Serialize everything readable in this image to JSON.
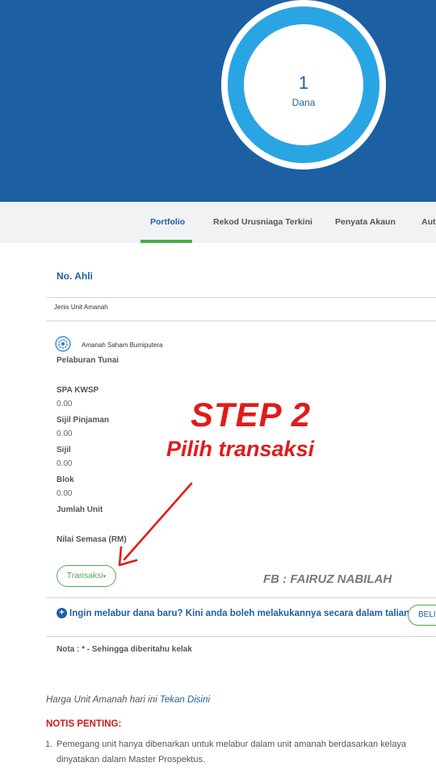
{
  "summary": {
    "count": "1",
    "label": "Dana"
  },
  "tabs": [
    {
      "label": "Portfolio",
      "active": true
    },
    {
      "label": "Rekod Urusniaga Terkini",
      "active": false
    },
    {
      "label": "Penyata Akaun",
      "active": false
    },
    {
      "label": "Aut",
      "active": false
    }
  ],
  "account": {
    "member_label": "No. Ahli",
    "fund_type_label": "Jenis Unit Amanah",
    "fund_name": "Amanah Saham Bumiputera",
    "fields": [
      {
        "label": "Pelaburan Tunai",
        "value": ""
      },
      {
        "label": "SPA KWSP",
        "value": "0.00"
      },
      {
        "label": "Sijil Pinjaman",
        "value": "0.00"
      },
      {
        "label": "Sijil",
        "value": "0.00"
      },
      {
        "label": "Blok",
        "value": "0.00"
      },
      {
        "label": "Jumlah Unit",
        "value": ""
      },
      {
        "label": "Nilai Semasa (RM)",
        "value": ""
      }
    ],
    "transaction_button": "Transaksi",
    "transaction_caret": "▾"
  },
  "invest": {
    "text": "Ingin melabur dana baru? Kini anda boleh melakukannya secara dalam talian.",
    "button": "BELI"
  },
  "note": "Nota : * - Sehingga diberitahu kelak",
  "price": {
    "text": "Harga Unit Amanah hari ini",
    "link": "Tekan Disini"
  },
  "notice": {
    "title": "NOTIS PENTING:",
    "items": [
      {
        "number": "1.",
        "line1": "Pemegang unit hanya dibenarkan untuk melabur dalam unit amanah berdasarkan kelaya",
        "line2": "dinyatakan dalam Master Prospektus."
      }
    ]
  },
  "overlay": {
    "step": "STEP 2",
    "instruction": "Pilih transaksi",
    "credit": "FB : FAIRUZ NABILAH",
    "color": "#e01b1b"
  },
  "colors": {
    "brand": "#1d5fa3",
    "ring": "#2aa5e3",
    "accent": "#4cae4c",
    "alert": "#d0191b"
  }
}
